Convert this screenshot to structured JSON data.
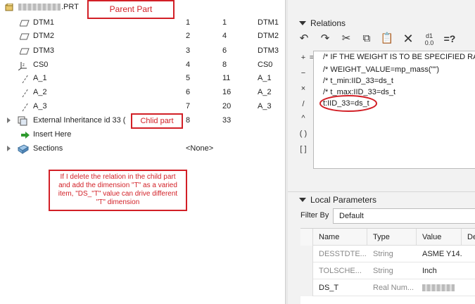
{
  "tree": {
    "root_label": ".PRT",
    "rows": [
      {
        "name": "DTM1",
        "c1": "1",
        "c2": "1",
        "c3": "DTM1"
      },
      {
        "name": "DTM2",
        "c1": "2",
        "c2": "4",
        "c3": "DTM2"
      },
      {
        "name": "DTM3",
        "c1": "3",
        "c2": "6",
        "c3": "DTM3"
      },
      {
        "name": "CS0",
        "c1": "4",
        "c2": "8",
        "c3": "CS0"
      },
      {
        "name": "A_1",
        "c1": "5",
        "c2": "11",
        "c3": "A_1"
      },
      {
        "name": "A_2",
        "c1": "6",
        "c2": "16",
        "c3": "A_2"
      },
      {
        "name": "A_3",
        "c1": "7",
        "c2": "20",
        "c3": "A_3"
      }
    ],
    "ext_label": "External Inheritance id 33 (",
    "ext_c1": "8",
    "ext_c2": "33",
    "insert_here": "Insert Here",
    "sections": "Sections",
    "sections_value": "<None>"
  },
  "callouts": {
    "parent": "Parent Part",
    "child": "Chlid part",
    "note": "If I delete the relation in the child part and add the dimension \"T\" as a varied item, \"DS_\"T\" value can drive different \"T\" dimension"
  },
  "relations": {
    "title": "Relations",
    "operators": [
      "+",
      "=",
      "−",
      "×",
      "/",
      "^",
      "( )",
      "[ ]"
    ],
    "lines": [
      "/* IF THE WEIGHT IS TO BE SPECIFIED RAT",
      "/* WEIGHT_VALUE=mp_mass(\"\")",
      "/* t_min:IID_33=ds_t",
      "/* t_max:IID_33=ds_t",
      "t:IID_33=ds_t"
    ]
  },
  "local_params": {
    "title": "Local Parameters",
    "filter_label": "Filter By",
    "filter_value": "Default",
    "columns": [
      "Name",
      "Type",
      "Value",
      "De"
    ],
    "rows": [
      {
        "name": "DESSTDTE...",
        "type": "String",
        "value": "ASME Y14...."
      },
      {
        "name": "TOLSCHE...",
        "type": "String",
        "value": "Inch"
      },
      {
        "name": "DS_T",
        "type": "Real Num...",
        "value": ""
      }
    ]
  },
  "colors": {
    "callout_red": "#d21f26",
    "editor_bg": "#ffffff",
    "panel_bg": "#f2f2f2"
  }
}
